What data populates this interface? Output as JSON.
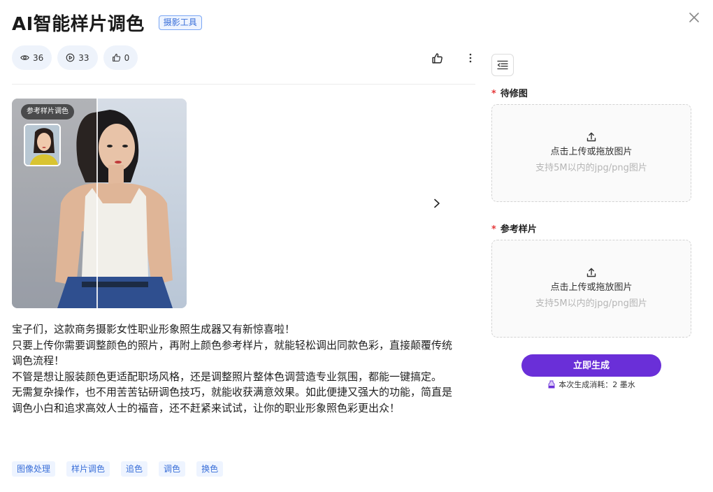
{
  "header": {
    "title": "AI智能样片调色",
    "category_tag": "摄影工具"
  },
  "stats": {
    "views": "36",
    "uses": "33",
    "likes": "0"
  },
  "preview": {
    "reference_badge": "参考样片调色"
  },
  "description": [
    "宝子们，这款商务摄影女性职业形象照生成器又有新惊喜啦！",
    "只要上传你需要调整颜色的照片，再附上颜色参考样片，就能轻松调出同款色彩，直接颠覆传统调色流程！",
    "不管是想让服装颜色更适配职场风格，还是调整照片整体色调营造专业氛围，都能一键搞定。",
    "无需复杂操作，也不用苦苦钻研调色技巧，就能收获满意效果。如此便捷又强大的功能，简直是调色小白和追求高效人士的福音，还不赶紧来试试，让你的职业形象照色彩更出众！"
  ],
  "tags": [
    "图像处理",
    "样片调色",
    "追色",
    "调色",
    "换色"
  ],
  "form": {
    "required_mark": "*",
    "field1_label": "待修图",
    "field2_label": "参考样片",
    "upload_text": "点击上传或拖放图片",
    "upload_hint": "支持5M以内的jpg/png图片"
  },
  "generate": {
    "button_label": "立即生成",
    "cost_text": "本次生成消耗：2 墨水"
  },
  "colors": {
    "accent": "#6a2fd8",
    "tag_blue": "#3a6fd8",
    "required_red": "#e5393b"
  },
  "icons": [
    "close-icon",
    "eye-icon",
    "play-icon",
    "thumb-up-icon",
    "more-vertical-icon",
    "chevron-right-icon",
    "panel-collapse-icon",
    "upload-icon",
    "ink-bottle-icon"
  ]
}
